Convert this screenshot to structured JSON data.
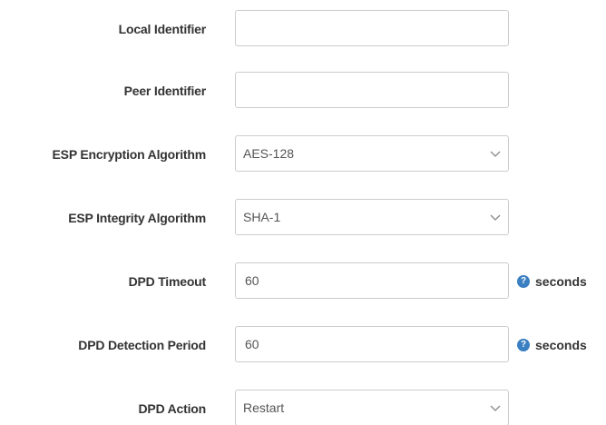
{
  "form": {
    "local_identifier": {
      "label": "Local Identifier",
      "value": ""
    },
    "peer_identifier": {
      "label": "Peer Identifier",
      "value": ""
    },
    "esp_encryption": {
      "label": "ESP Encryption Algorithm",
      "selected": "AES-128"
    },
    "esp_integrity": {
      "label": "ESP Integrity Algorithm",
      "selected": "SHA-1"
    },
    "dpd_timeout": {
      "label": "DPD Timeout",
      "value": "60",
      "unit": "seconds",
      "help_icon": "help-icon"
    },
    "dpd_detection_period": {
      "label": "DPD Detection Period",
      "value": "60",
      "unit": "seconds",
      "help_icon": "help-icon"
    },
    "dpd_action": {
      "label": "DPD Action",
      "selected": "Restart"
    }
  },
  "colors": {
    "label": "#333333",
    "field_border": "#cccccc",
    "field_text": "#555555",
    "help_icon": "#3a7fc1"
  }
}
